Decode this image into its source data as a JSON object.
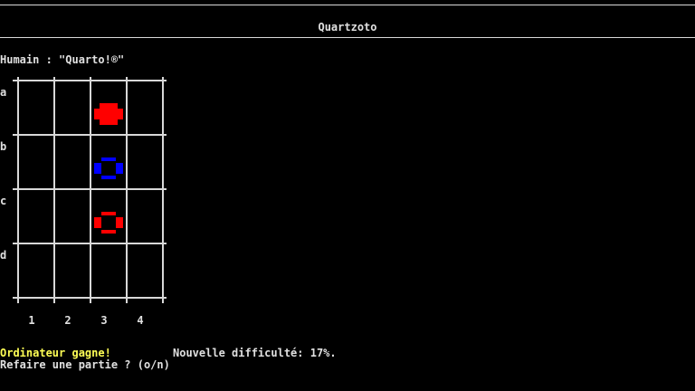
{
  "window": {
    "title": "Quartzoto"
  },
  "player_line": "Humain : \"Quarto!®\"",
  "board": {
    "row_labels": [
      "a",
      "b",
      "c",
      "d"
    ],
    "col_labels": [
      "1",
      "2",
      "3",
      "4"
    ],
    "pieces": [
      {
        "row": "a",
        "col": "3",
        "color": "red",
        "shape": "plus",
        "filled": true,
        "name": "piece-a3-red-plus-icon"
      },
      {
        "row": "b",
        "col": "3",
        "color": "blue",
        "shape": "ring",
        "filled": false,
        "name": "piece-b3-blue-ring-icon"
      },
      {
        "row": "c",
        "col": "3",
        "color": "red",
        "shape": "ring",
        "filled": false,
        "name": "piece-c3-red-ring-icon"
      }
    ]
  },
  "status": {
    "result": "Ordinateur gagne!",
    "difficulty": "Nouvelle difficulté: 17%.",
    "prompt": "Refaire une partie ? (o/n)"
  },
  "colors": {
    "background": "#000000",
    "text": "#e0e0e0",
    "result_text": "#ffff55",
    "grid": "#d8d8d8",
    "red": "#ff0000",
    "blue": "#0000ff"
  }
}
